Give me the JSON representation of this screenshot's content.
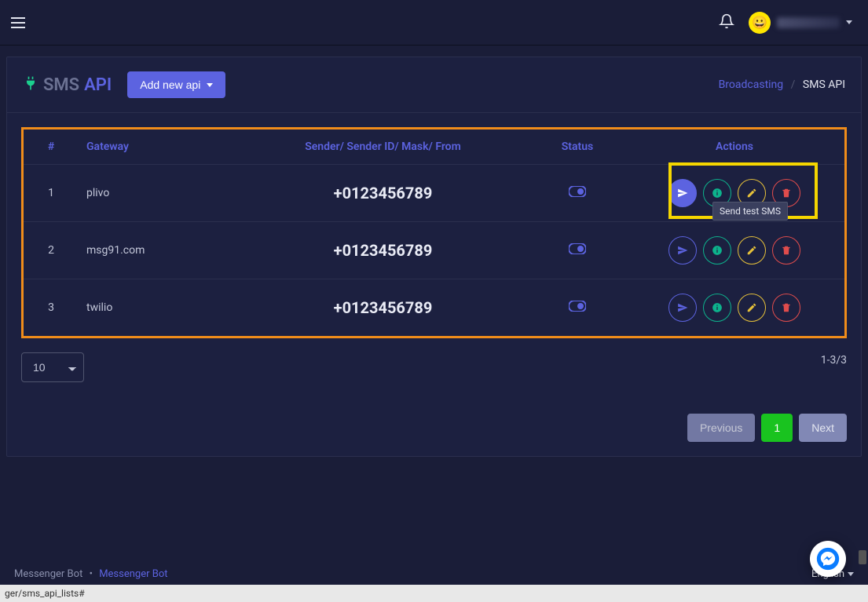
{
  "topbar": {
    "user_name": "redacted"
  },
  "page": {
    "title_left": "SMS",
    "title_right": "API",
    "add_button": "Add new api"
  },
  "breadcrumb": {
    "parent": "Broadcasting",
    "current": "SMS API"
  },
  "table": {
    "headers": {
      "num": "#",
      "gateway": "Gateway",
      "sender": "Sender/ Sender ID/ Mask/ From",
      "status": "Status",
      "actions": "Actions"
    },
    "rows": [
      {
        "num": "1",
        "gateway": "plivo",
        "sender": "+0123456789",
        "status_on": true
      },
      {
        "num": "2",
        "gateway": "msg91.com",
        "sender": "+0123456789",
        "status_on": true
      },
      {
        "num": "3",
        "gateway": "twilio",
        "sender": "+0123456789",
        "status_on": true
      }
    ]
  },
  "tooltip": "Send test SMS",
  "page_size": "10",
  "range": "1-3/3",
  "pager": {
    "prev": "Previous",
    "page": "1",
    "next": "Next"
  },
  "footer": {
    "left_text": "Messenger Bot",
    "left_link": "Messenger Bot",
    "language": "English"
  },
  "statusbar": "ger/sms_api_lists#"
}
